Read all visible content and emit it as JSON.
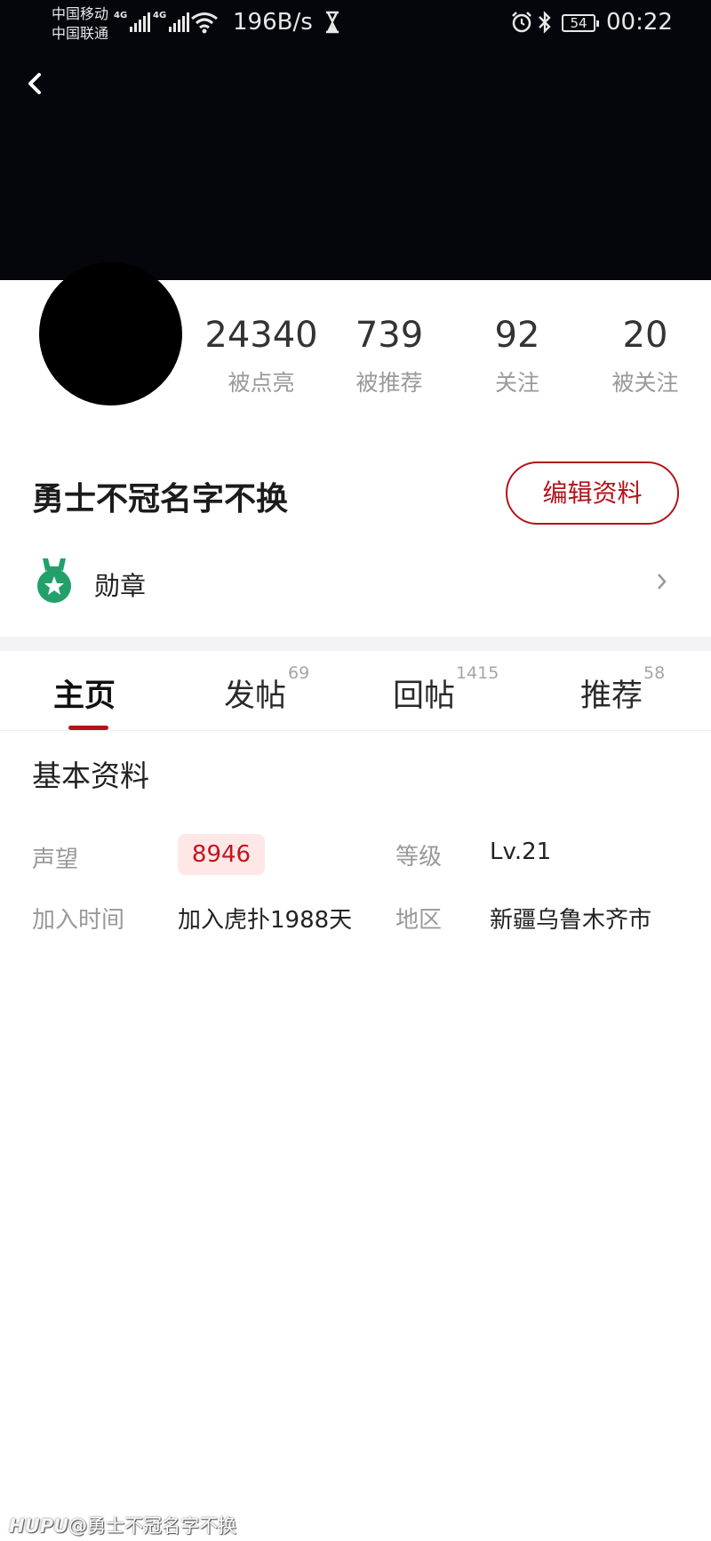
{
  "status_bar": {
    "carrier_1": "中国移动",
    "carrier_2": "中国联通",
    "signal_1_type": "4G",
    "signal_2_type": "4G",
    "net_speed": "196B/s",
    "battery": "54",
    "time": "00:22"
  },
  "profile": {
    "stats": [
      {
        "value": "24340",
        "label": "被点亮"
      },
      {
        "value": "739",
        "label": "被推荐"
      },
      {
        "value": "92",
        "label": "关注"
      },
      {
        "value": "20",
        "label": "被关注"
      }
    ],
    "username": "勇士不冠名字不换",
    "edit_button": "编辑资料",
    "medal_label": "勋章"
  },
  "tabs": [
    {
      "label": "主页",
      "count": ""
    },
    {
      "label": "发帖",
      "count": "69"
    },
    {
      "label": "回帖",
      "count": "1415"
    },
    {
      "label": "推荐",
      "count": "58"
    }
  ],
  "basic_info": {
    "title": "基本资料",
    "prestige_label": "声望",
    "prestige_value": "8946",
    "level_label": "等级",
    "level_value": "Lv.21",
    "join_label": "加入时间",
    "join_value": "加入虎扑1988天",
    "region_label": "地区",
    "region_value": "新疆乌鲁木齐市"
  },
  "watermark": {
    "brand": "HUPU",
    "handle": "@勇士不冠名字不换"
  },
  "colors": {
    "accent": "#b3131b",
    "header_bg": "#05060b",
    "medal": "#23a06a"
  }
}
